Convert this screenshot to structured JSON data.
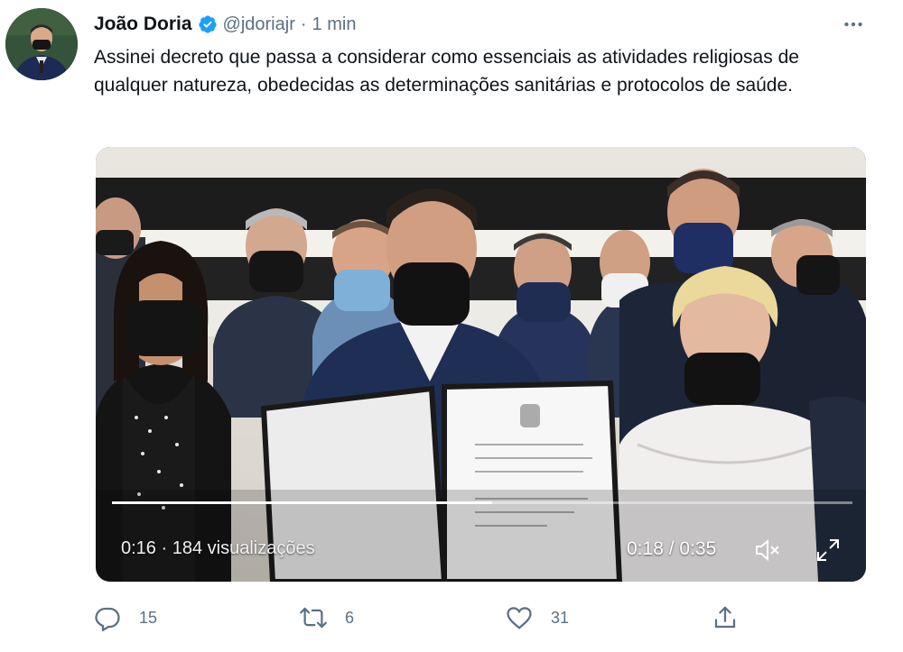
{
  "author": {
    "name": "João Doria",
    "handle": "@jdoriajr",
    "separator": "·",
    "time": "1 min"
  },
  "tweet": {
    "text": "Assinei decreto que passa a considerar como essenciais as atividades religiosas de qualquer natureza, obedecidas as determinações sanitárias e protocolos de saúde."
  },
  "video": {
    "views_label": "0:16 · 184 visualizações",
    "time_label": "0:18 / 0:35",
    "progress": 0.514
  },
  "actions": {
    "reply_count": "15",
    "retweet_count": "6",
    "like_count": "31"
  },
  "icons": {
    "verified": "verified-badge-icon",
    "more": "more-dots-icon",
    "mute": "volume-muted-icon",
    "fullscreen": "fullscreen-icon",
    "reply": "reply-icon",
    "retweet": "retweet-icon",
    "like": "like-icon",
    "share": "share-icon"
  },
  "colors": {
    "verified_blue": "#1da1f2",
    "muted_text": "#5b7083"
  }
}
